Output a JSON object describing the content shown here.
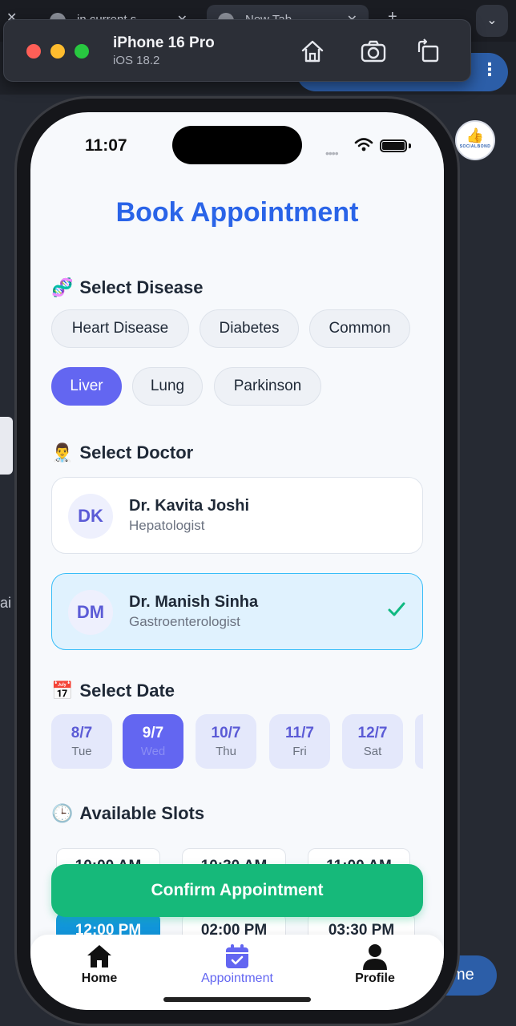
{
  "browser": {
    "tabs": [
      {
        "label": "in current s..."
      },
      {
        "label": "New Tab"
      }
    ],
    "side_text": "ai",
    "socialbond_label": "SOCIALBOND",
    "home_button_label": "me"
  },
  "simulator": {
    "device_name": "iPhone 16 Pro",
    "os_version": "iOS 18.2",
    "toolbar_icons": [
      "home-icon",
      "screenshot-icon",
      "rotate-icon"
    ]
  },
  "status_bar": {
    "time": "11:07"
  },
  "page": {
    "title": "Book Appointment"
  },
  "sections": {
    "disease": {
      "emoji": "🧬",
      "label": "Select Disease"
    },
    "doctor": {
      "emoji": "👨‍⚕️",
      "label": "Select Doctor"
    },
    "date": {
      "emoji": "📅",
      "label": "Select Date"
    },
    "slots": {
      "emoji": "🕒",
      "label": "Available Slots"
    }
  },
  "diseases": [
    {
      "label": "Heart Disease",
      "selected": false
    },
    {
      "label": "Diabetes",
      "selected": false
    },
    {
      "label": "Common",
      "selected": false
    },
    {
      "label": "Liver",
      "selected": true
    },
    {
      "label": "Lung",
      "selected": false
    },
    {
      "label": "Parkinson",
      "selected": false
    }
  ],
  "doctors": [
    {
      "initials": "DK",
      "name": "Dr. Kavita Joshi",
      "specialty": "Hepatologist",
      "selected": false
    },
    {
      "initials": "DM",
      "name": "Dr. Manish Sinha",
      "specialty": "Gastroenterologist",
      "selected": true
    }
  ],
  "dates": [
    {
      "date": "8/7",
      "weekday": "Tue",
      "selected": false
    },
    {
      "date": "9/7",
      "weekday": "Wed",
      "selected": true
    },
    {
      "date": "10/7",
      "weekday": "Thu",
      "selected": false
    },
    {
      "date": "11/7",
      "weekday": "Fri",
      "selected": false
    },
    {
      "date": "12/7",
      "weekday": "Sat",
      "selected": false
    }
  ],
  "slots": [
    {
      "time": "10:00 AM",
      "selected": false
    },
    {
      "time": "10:30 AM",
      "selected": false
    },
    {
      "time": "11:00 AM",
      "selected": false
    },
    {
      "time": "12:00 PM",
      "selected": true
    },
    {
      "time": "02:00 PM",
      "selected": false
    },
    {
      "time": "03:30 PM",
      "selected": false
    }
  ],
  "confirm_button": {
    "label": "Confirm Appointment"
  },
  "tabbar": [
    {
      "label": "Home",
      "icon": "home-icon",
      "active": false
    },
    {
      "label": "Appointment",
      "icon": "calendar-check-icon",
      "active": true
    },
    {
      "label": "Profile",
      "icon": "person-icon",
      "active": false
    }
  ],
  "colors": {
    "accent": "#6366f1",
    "title_blue": "#2a64e8",
    "confirm_green": "#16b97a",
    "slot_selected": "#1296db"
  }
}
